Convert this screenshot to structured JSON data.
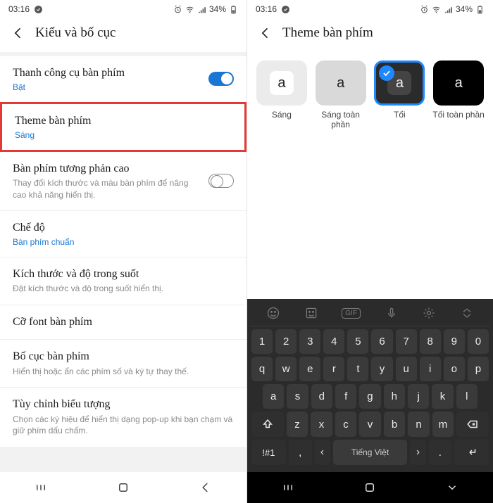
{
  "status": {
    "time": "03:16",
    "battery_text": "34%"
  },
  "left": {
    "title": "Kiểu và bố cục",
    "items": {
      "toolbar": {
        "title": "Thanh công cụ bàn phím",
        "sub": "Bật"
      },
      "theme": {
        "title": "Theme bàn phím",
        "sub": "Sáng"
      },
      "high_contrast": {
        "title": "Bàn phím tương phản cao",
        "desc": "Thay đổi kích thước và màu bàn phím để nâng cao khả năng hiển thị."
      },
      "mode": {
        "title": "Chế độ",
        "sub": "Bàn phím chuẩn"
      },
      "size": {
        "title": "Kích thước và độ trong suốt",
        "desc": "Đặt kích thước và độ trong suốt hiển thị."
      },
      "font": {
        "title": "Cỡ font bàn phím"
      },
      "layout": {
        "title": "Bố cục bàn phím",
        "desc": "Hiển thị hoặc ẩn các phím số và ký tự thay thế."
      },
      "custom": {
        "title": "Tùy chỉnh biểu tượng",
        "desc": "Chọn các ký hiệu để hiển thị dạng pop-up khi bạn chạm và giữ phím dấu chấm."
      }
    }
  },
  "right": {
    "title": "Theme bàn phím",
    "themes": [
      {
        "label": "Sáng"
      },
      {
        "label": "Sáng toàn phần"
      },
      {
        "label": "Tối"
      },
      {
        "label": "Tối toàn phần"
      }
    ],
    "sample_char": "a"
  },
  "keyboard": {
    "row_num": [
      "1",
      "2",
      "3",
      "4",
      "5",
      "6",
      "7",
      "8",
      "9",
      "0"
    ],
    "row1": [
      "q",
      "w",
      "e",
      "r",
      "t",
      "y",
      "u",
      "i",
      "o",
      "p"
    ],
    "row2": [
      "a",
      "s",
      "d",
      "f",
      "g",
      "h",
      "j",
      "k",
      "l"
    ],
    "row3": [
      "z",
      "x",
      "c",
      "v",
      "b",
      "n",
      "m"
    ],
    "symkey": "!#1",
    "comma": ",",
    "language": "Tiếng Việt",
    "period": "."
  }
}
